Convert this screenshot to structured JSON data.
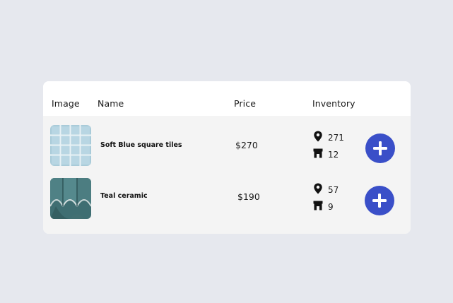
{
  "colors": {
    "page_bg": "#e6e8ee",
    "card_bg": "#ffffff",
    "rows_bg": "#f4f4f4",
    "accent": "#3a4fc8"
  },
  "table": {
    "headers": {
      "image": "Image",
      "name": "Name",
      "price": "Price",
      "inventory": "Inventory"
    },
    "rows": [
      {
        "image_icon": "blue-square-tiles-thumbnail",
        "name": "Soft Blue square tiles",
        "price": "$270",
        "location_icon": "map-pin-icon",
        "location_qty": "271",
        "store_icon": "store-icon",
        "store_qty": "12",
        "action_icon": "plus-icon"
      },
      {
        "image_icon": "teal-ceramic-thumbnail",
        "name": "Teal ceramic",
        "price": "$190",
        "location_icon": "map-pin-icon",
        "location_qty": "57",
        "store_icon": "store-icon",
        "store_qty": "9",
        "action_icon": "plus-icon"
      }
    ]
  }
}
